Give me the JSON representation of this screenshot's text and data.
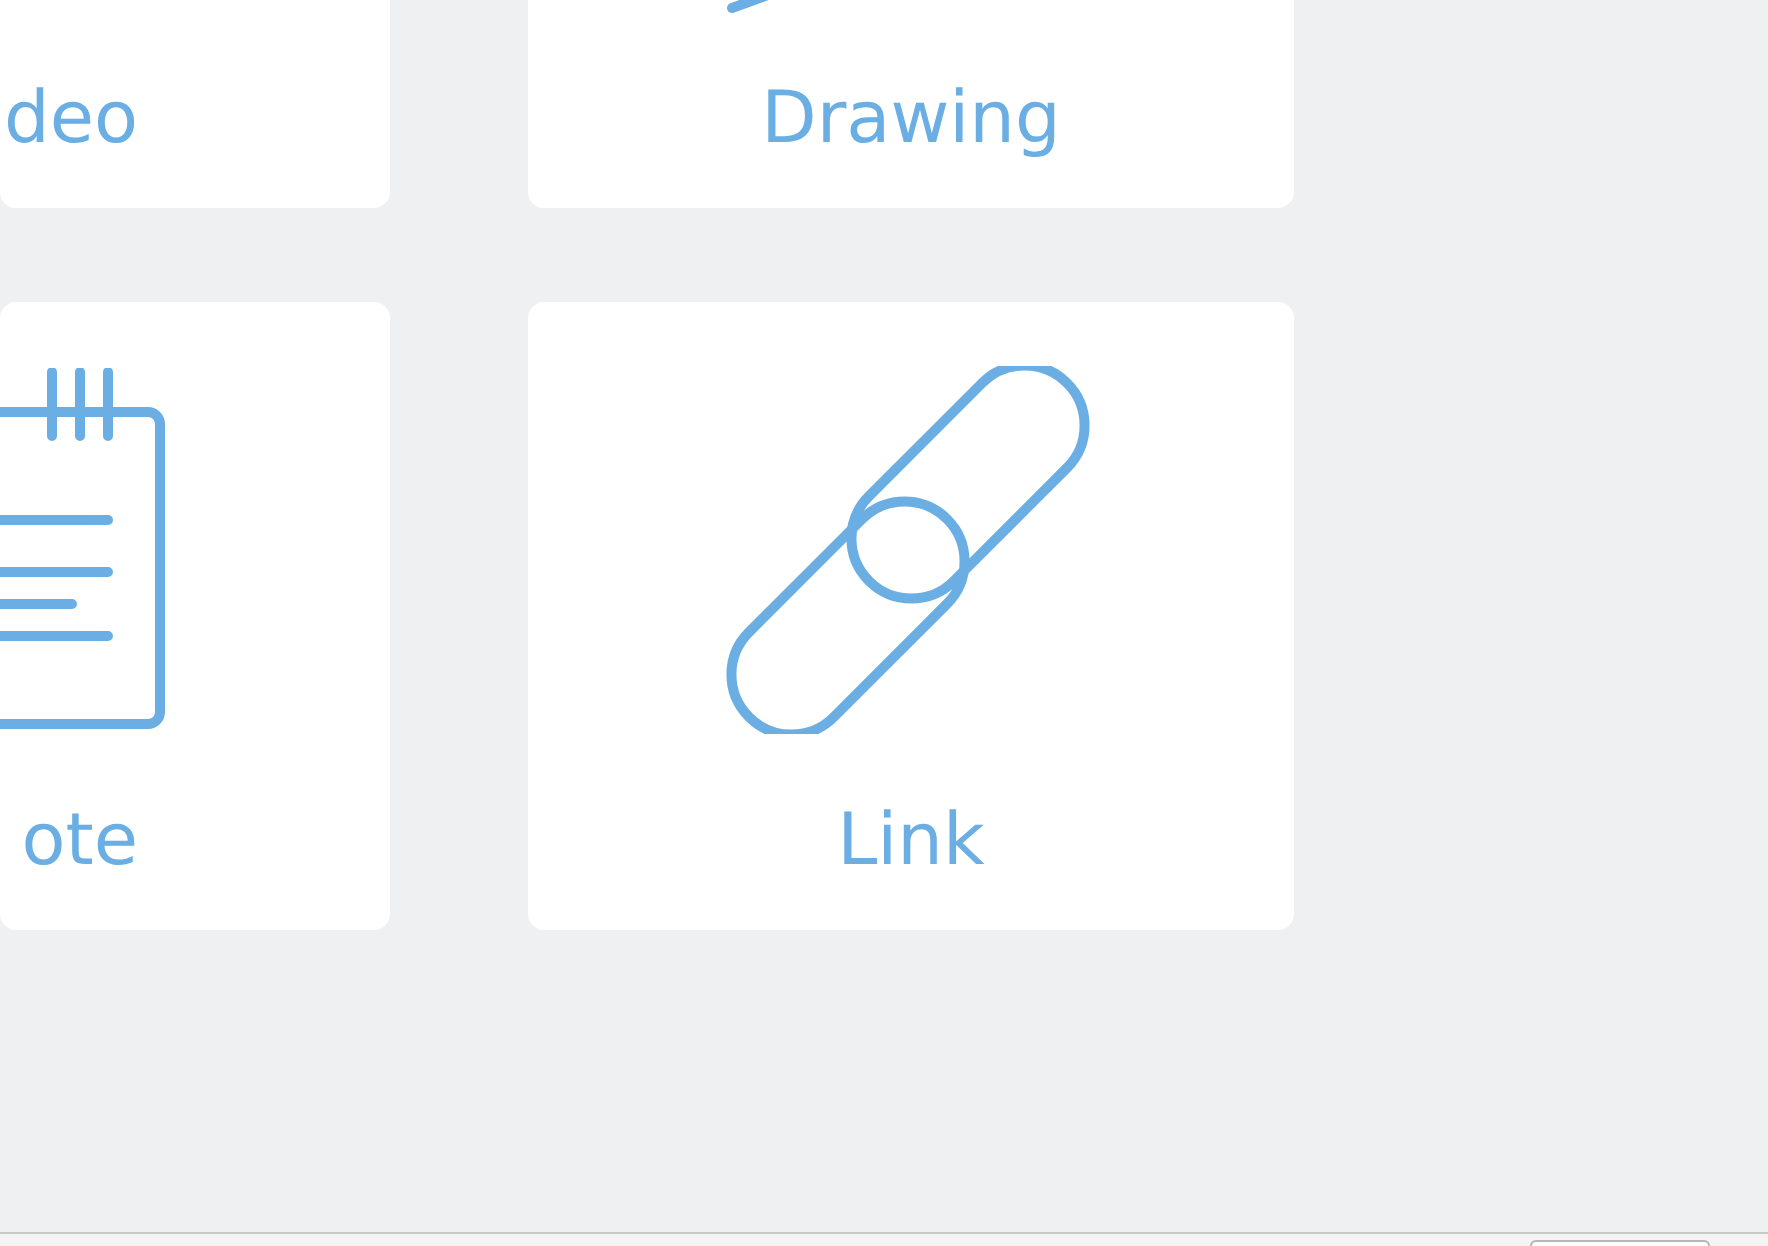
{
  "cards": [
    {
      "label": "deo"
    },
    {
      "label": "Drawing"
    },
    {
      "label": "ote"
    },
    {
      "label": "Link"
    }
  ]
}
